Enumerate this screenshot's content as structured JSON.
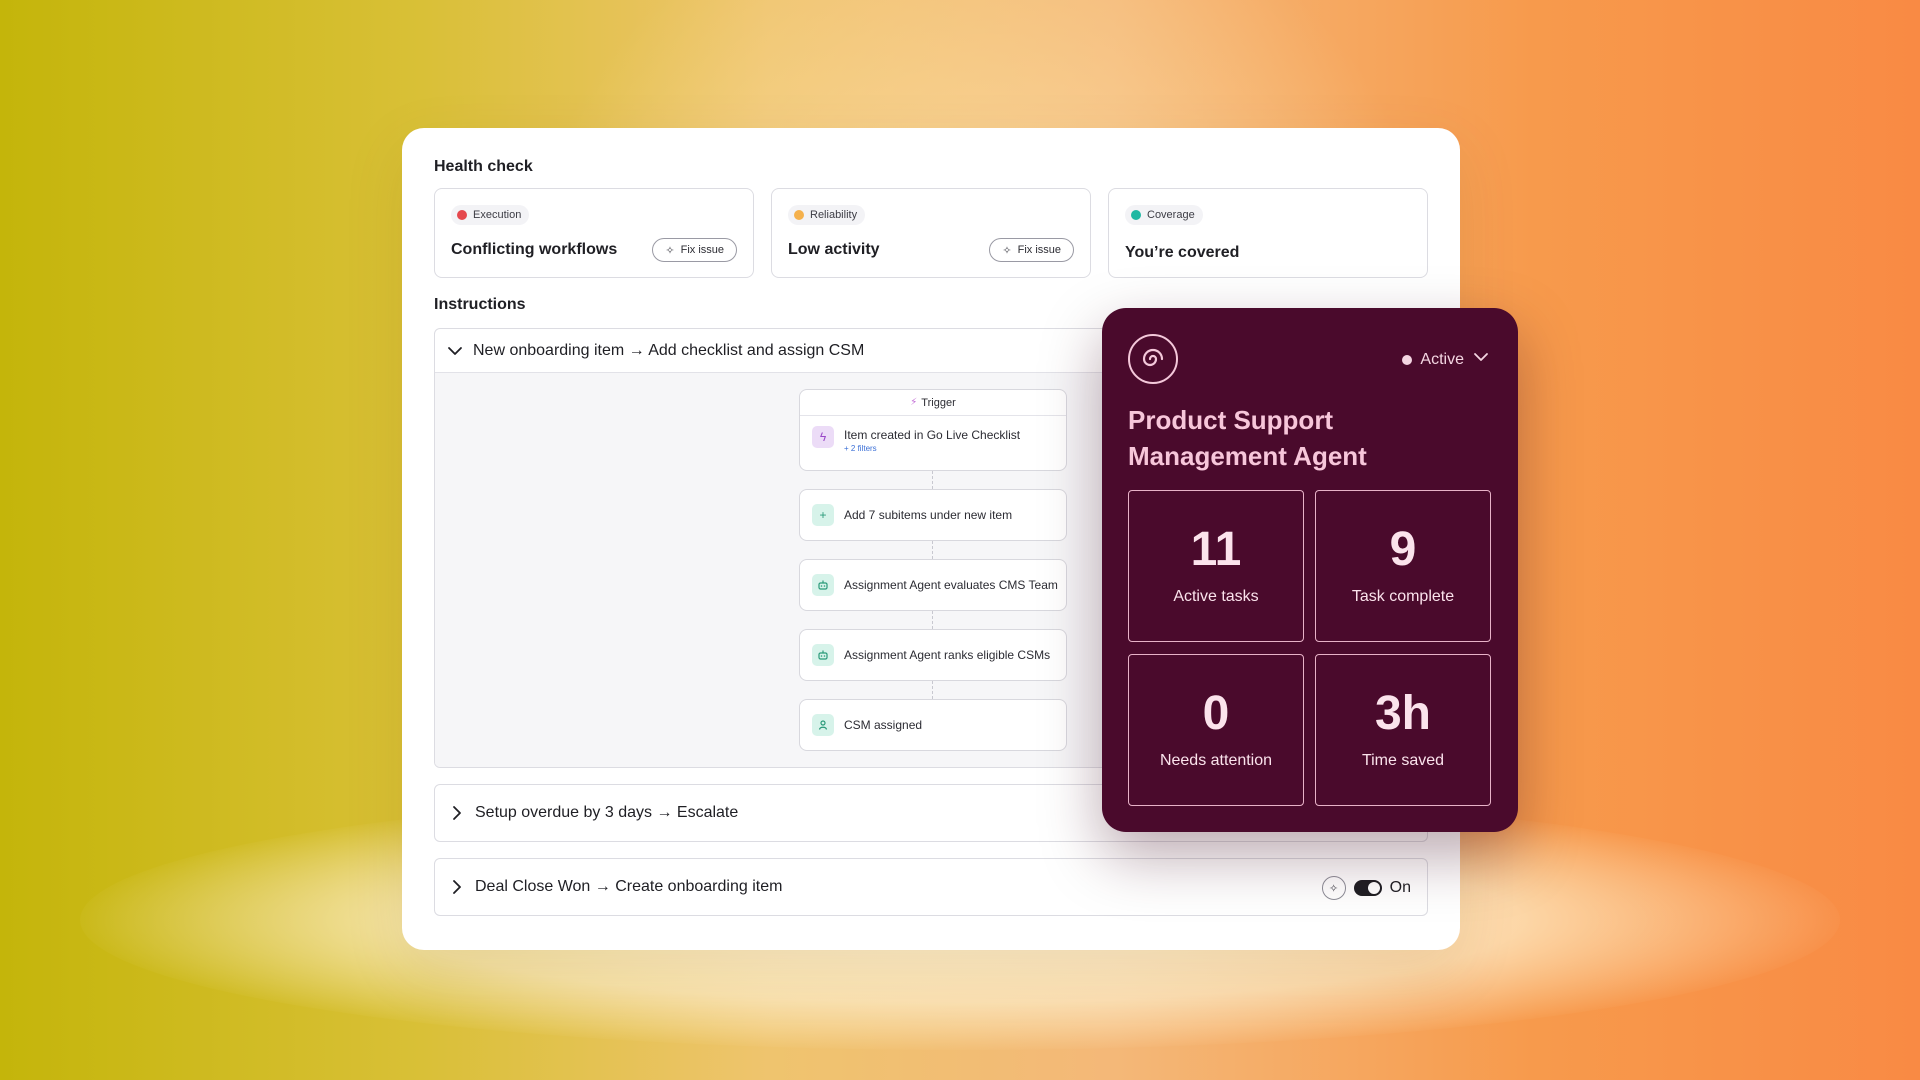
{
  "health_check": {
    "title": "Health check",
    "cards": [
      {
        "tag": "Execution",
        "tag_color": "#e5484d",
        "title": "Conflicting workflows",
        "action": "Fix issue"
      },
      {
        "tag": "Reliability",
        "tag_color": "#f5b14c",
        "title": "Low activity",
        "action": "Fix issue"
      },
      {
        "tag": "Coverage",
        "tag_color": "#1fb8a3",
        "title": "You’re covered"
      }
    ]
  },
  "instructions": {
    "title": "Instructions",
    "rules": [
      {
        "label": "New onboarding item → Add checklist and assign CSM",
        "expanded": true,
        "flow": {
          "trigger_label": "Trigger",
          "trigger_text": "Item created in Go Live Checklist",
          "trigger_sub": "+ 2 filters",
          "steps": [
            {
              "text": "Add 7 subitems under new item",
              "icon": "plus-icon"
            },
            {
              "text": "Assignment Agent evaluates CMS Team",
              "icon": "robot-icon"
            },
            {
              "text": "Assignment Agent ranks eligible CSMs",
              "icon": "robot-icon"
            },
            {
              "text": "CSM assigned",
              "icon": "person-icon"
            }
          ]
        }
      },
      {
        "label": "Setup overdue by 3 days → Escalate",
        "expanded": false
      },
      {
        "label": "Deal Close Won → Create onboarding item",
        "expanded": false,
        "toggle_label": "On",
        "toggle_on": true
      }
    ]
  },
  "agent": {
    "name": "Product Support Management Agent",
    "status": "Active",
    "accent": "#4a0a2c",
    "stats": [
      {
        "value": "11",
        "label": "Active tasks"
      },
      {
        "value": "9",
        "label": "Task complete"
      },
      {
        "value": "0",
        "label": "Needs attention"
      },
      {
        "value": "3h",
        "label": "Time saved"
      }
    ]
  }
}
